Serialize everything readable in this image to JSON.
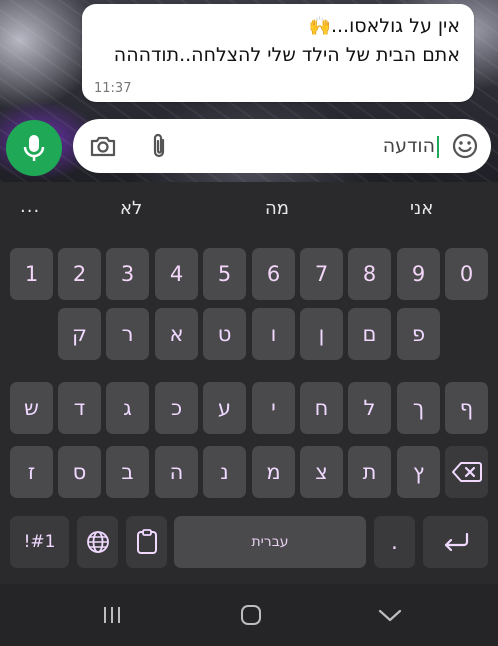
{
  "chat": {
    "message": {
      "line1": "אין על גולאסו...",
      "line1_emoji": "🙌",
      "line2": "אתם הבית של הילד שלי להצלחה..תודההה",
      "time": "11:37"
    }
  },
  "composer": {
    "value": "הודעה",
    "icons": [
      "camera-icon",
      "paperclip-icon",
      "smiley-icon",
      "microphone-icon"
    ],
    "accent": "#1fa855"
  },
  "keyboard": {
    "suggestions": [
      "אני",
      "מה",
      "לא"
    ],
    "more_label": "...",
    "number_row": [
      "1",
      "2",
      "3",
      "4",
      "5",
      "6",
      "7",
      "8",
      "9",
      "0"
    ],
    "row1": [
      "ק",
      "ר",
      "א",
      "ט",
      "ו",
      "ן",
      "ם",
      "פ"
    ],
    "row2": [
      "ש",
      "ד",
      "ג",
      "כ",
      "ע",
      "י",
      "ח",
      "ל",
      "ך",
      "ף"
    ],
    "row3": [
      "ז",
      "ס",
      "ב",
      "ה",
      "נ",
      "מ",
      "צ",
      "ת",
      "ץ"
    ],
    "symbols_label": "!#1",
    "space_label": "עברית",
    "period_label": ".",
    "key_color": "#4a4a4d",
    "key_text_color": "#f0d8ff"
  },
  "navbar": {
    "icons": [
      "recent-apps-icon",
      "home-icon",
      "back-icon"
    ]
  }
}
